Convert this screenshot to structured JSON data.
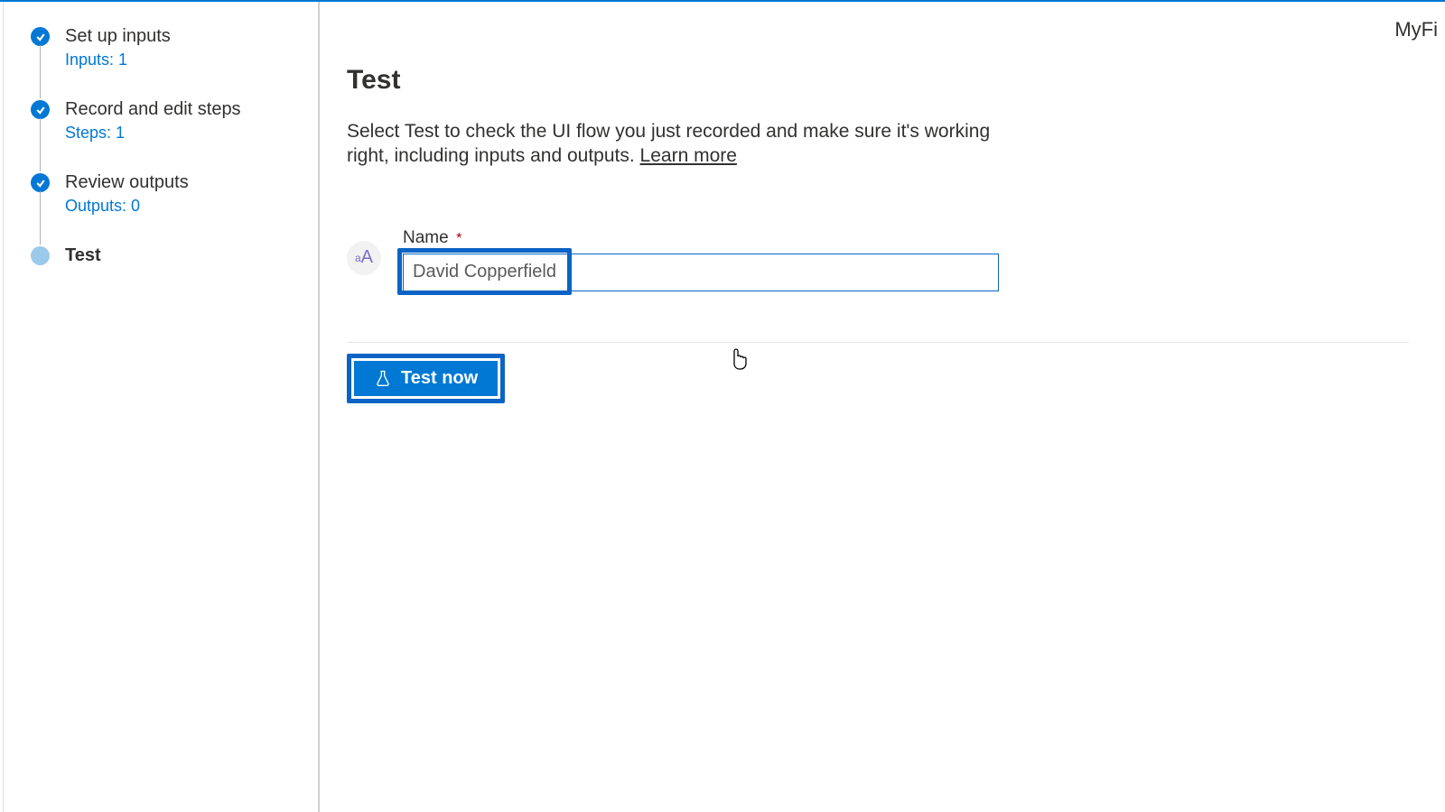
{
  "header": {
    "clipped_text": "MyFi"
  },
  "sidebar": {
    "steps": [
      {
        "title": "Set up inputs",
        "sub": "Inputs: 1",
        "state": "done"
      },
      {
        "title": "Record and edit steps",
        "sub": "Steps: 1",
        "state": "done"
      },
      {
        "title": "Review outputs",
        "sub": "Outputs: 0",
        "state": "done"
      },
      {
        "title": "Test",
        "sub": "",
        "state": "current"
      }
    ]
  },
  "main": {
    "title": "Test",
    "description": "Select Test to check the UI flow you just recorded and make sure it's working right, including inputs and outputs. ",
    "learn_more": "Learn more",
    "field": {
      "icon": "aA",
      "label": "Name",
      "required_mark": "*",
      "value": "David Copperfield"
    },
    "test_button": "Test now"
  }
}
